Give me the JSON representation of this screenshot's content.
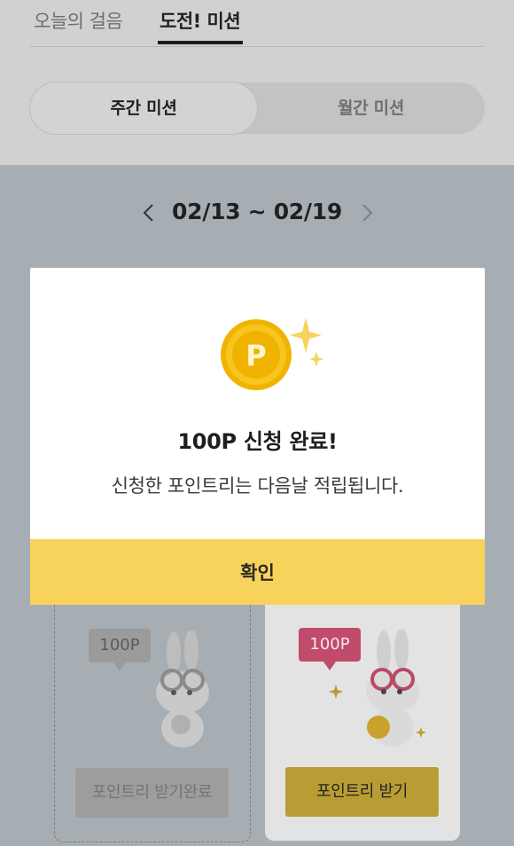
{
  "tabs": [
    {
      "label": "오늘의 걸음",
      "active": false
    },
    {
      "label": "도전! 미션",
      "active": true
    }
  ],
  "segment": {
    "weekly": "주간 미션",
    "monthly": "월간 미션",
    "selected": "weekly"
  },
  "week_nav": {
    "range": "02/13 ~ 02/19",
    "prev_icon": "chevron-left-icon",
    "next_icon": "chevron-right-icon"
  },
  "cards": [
    {
      "reward": "100P",
      "button_label": "포인트리 받기완료",
      "state": "completed"
    },
    {
      "reward": "100P",
      "button_label": "포인트리 받기",
      "state": "available"
    }
  ],
  "modal": {
    "coin_icon": "point-coin-icon",
    "coin_letter": "P",
    "title": "100P 신청 완료!",
    "message": "신청한 포인트리는 다음날 적립됩니다.",
    "confirm_label": "확인"
  },
  "colors": {
    "accent_yellow": "#f8d35b",
    "bubble_pink": "#c04b6b",
    "overlay": "#a7aeb3"
  }
}
